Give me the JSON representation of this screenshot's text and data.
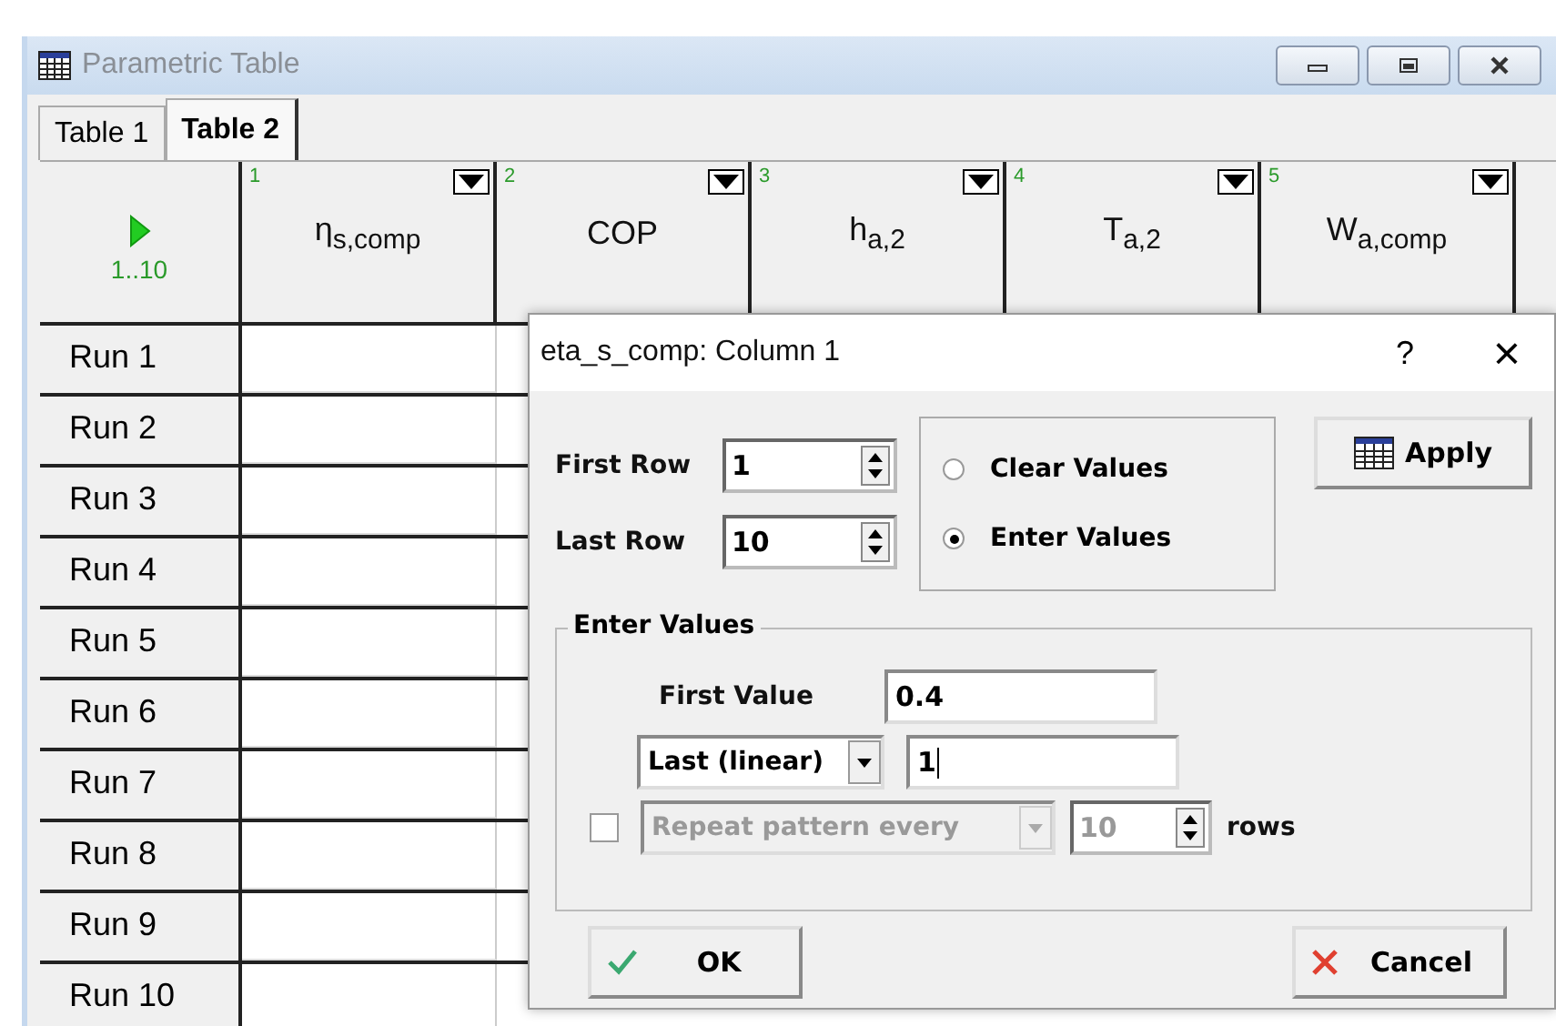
{
  "window": {
    "title": "Parametric Table"
  },
  "tabs": [
    {
      "label": "Table 1",
      "selected": false
    },
    {
      "label": "Table 2",
      "selected": true
    }
  ],
  "table": {
    "corner": "1..10",
    "columns": [
      {
        "number": "1",
        "label": "η$_{s,comp}$"
      },
      {
        "number": "2",
        "label": "COP"
      },
      {
        "number": "3",
        "label": "h$_{a,2}$"
      },
      {
        "number": "4",
        "label": "T$_{a,2}$"
      },
      {
        "number": "5",
        "label": "W$_{a,comp}$"
      }
    ],
    "rows": [
      "Run 1",
      "Run 2",
      "Run 3",
      "Run 4",
      "Run 5",
      "Run 6",
      "Run 7",
      "Run 8",
      "Run 9",
      "Run 10"
    ]
  },
  "dialog": {
    "title": "eta_s_comp:  Column 1",
    "help": "?",
    "close": "×",
    "first_row": {
      "label": "First Row",
      "value": "1"
    },
    "last_row": {
      "label": "Last Row",
      "value": "10"
    },
    "options": [
      {
        "label": "Clear Values",
        "selected": false
      },
      {
        "label": "Enter Values",
        "selected": true
      }
    ],
    "apply": "Apply",
    "group": {
      "title": "Enter Values",
      "first_value": {
        "label": "First Value",
        "value": "0.4"
      },
      "mode": {
        "value": "Last (linear)"
      },
      "last_value": "1",
      "repeat": {
        "checked": false,
        "disabled": true,
        "value": "Repeat pattern every",
        "count": "10",
        "unit": "rows"
      }
    },
    "ok": "OK",
    "cancel": "Cancel"
  }
}
